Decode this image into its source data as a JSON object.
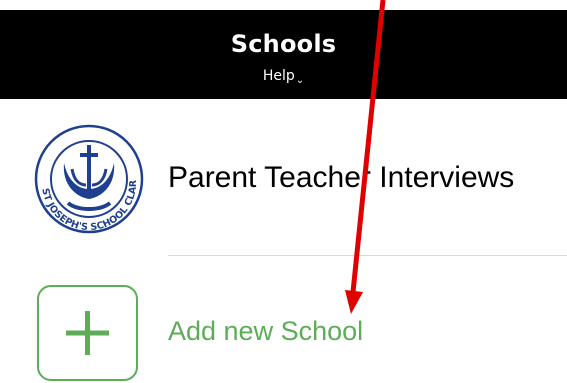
{
  "header": {
    "title": "Schools",
    "help_label": "Help",
    "help_chevron": "⌄"
  },
  "schools": [
    {
      "name": "Parent Teacher Interviews",
      "logo_icon": "st-josephs-school-crest-icon",
      "logo_text": "ST JOSEPH'S SCHOOL CLARE"
    }
  ],
  "add_school": {
    "label": "Add new School",
    "icon": "plus-icon"
  },
  "colors": {
    "header_bg": "#000000",
    "accent_green": "#5cad56",
    "logo_blue": "#1f3f8f",
    "annotation_red": "#e00000"
  }
}
